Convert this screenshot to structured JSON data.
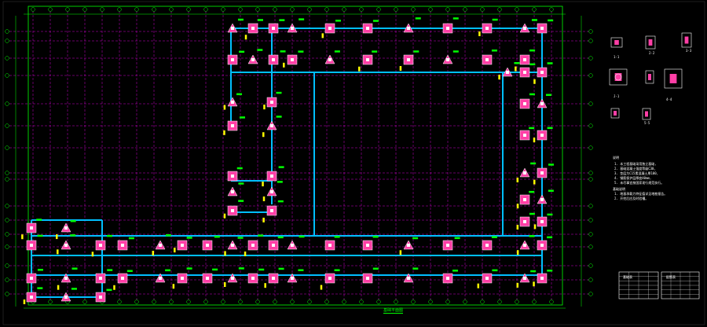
{
  "colors": {
    "background": "#000000",
    "frame": "#00ff00",
    "grid_axis": "#ff00ff",
    "beam": "#00bfff",
    "footing_fill": "#ff3fa6",
    "column": "#ffffff",
    "annotation": "#00ff00",
    "dimension": "#ffff00",
    "text": "#ffffff"
  },
  "drawing": {
    "plan_title": "基础平面图",
    "notes": {
      "title": "说明",
      "lines": [
        "1. 本工程基础采用独立基础,",
        "2. 基础混凝土强度等级C30,",
        "3. 垫层为C15素混凝土厚100,",
        "4. 钢筋保护层厚度40mm,",
        "5. 未尽事宜按国家现行规范执行。"
      ],
      "sub_title": "基础说明",
      "sub_lines": [
        "1. 地基承载力特征值详见地勘报告。",
        "2. 开挖后应及时验槽。"
      ]
    },
    "details": [
      {
        "label": "1-1"
      },
      {
        "label": "2-2"
      },
      {
        "label": "3-3"
      },
      {
        "label": "J-1"
      },
      {
        "label": "4-4"
      },
      {
        "label": "5-5"
      }
    ],
    "tables": [
      {
        "title": "基础表",
        "rows": 5
      },
      {
        "title": "配筋表",
        "rows": 5
      }
    ]
  }
}
